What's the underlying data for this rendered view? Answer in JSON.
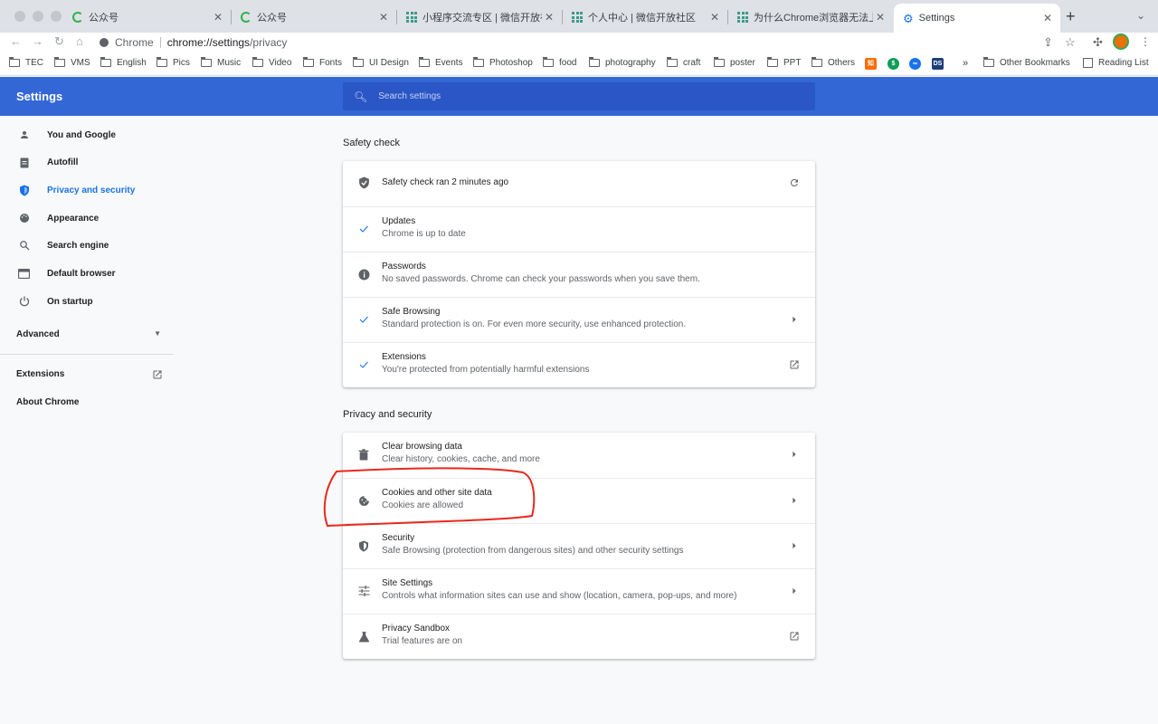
{
  "tabs": [
    {
      "title": "公众号",
      "favicon": "wechat-green-icon"
    },
    {
      "title": "公众号",
      "favicon": "wechat-green-icon"
    },
    {
      "title": "小程序交流专区 | 微信开放社区",
      "favicon": "wechat-dev-icon"
    },
    {
      "title": "个人中心 | 微信开放社区",
      "favicon": "wechat-dev-icon"
    },
    {
      "title": "为什么Chrome浏览器无法上传图",
      "favicon": "wechat-dev-icon"
    },
    {
      "title": "Settings",
      "favicon": "settings-gear-icon",
      "active": true
    }
  ],
  "toolbar": {
    "site_label": "Chrome",
    "url_host": "chrome://settings",
    "url_path": "/privacy"
  },
  "bookmarks": {
    "items": [
      "TEC",
      "VMS",
      "English",
      "Pics",
      "Music",
      "Video",
      "Fonts",
      "UI Design",
      "Events",
      "Photoshop",
      "food",
      "photography",
      "craft",
      "poster",
      "PPT",
      "Others"
    ],
    "badges": [
      {
        "text": "知",
        "color": "#ff6a00"
      },
      {
        "text": "$",
        "color": "#0f9d58"
      },
      {
        "text": "∞",
        "color": "#1a73e8"
      },
      {
        "text": "DS",
        "color": "#1d3f7a"
      }
    ],
    "more": "»",
    "other_bookmarks": "Other Bookmarks",
    "reading_list": "Reading List"
  },
  "header": {
    "title": "Settings",
    "search_placeholder": "Search settings"
  },
  "sidebar": {
    "items": [
      {
        "label": "You and Google",
        "icon": "person-icon"
      },
      {
        "label": "Autofill",
        "icon": "clipboard-icon"
      },
      {
        "label": "Privacy and security",
        "icon": "shield-icon",
        "active": true
      },
      {
        "label": "Appearance",
        "icon": "palette-icon"
      },
      {
        "label": "Search engine",
        "icon": "search-icon"
      },
      {
        "label": "Default browser",
        "icon": "browser-window-icon"
      },
      {
        "label": "On startup",
        "icon": "power-icon"
      }
    ],
    "advanced": "Advanced",
    "extensions": "Extensions",
    "about": "About Chrome"
  },
  "safety_check": {
    "title": "Safety check",
    "status": "Safety check ran 2 minutes ago",
    "rows": [
      {
        "title": "Updates",
        "subtitle": "Chrome is up to date",
        "icon": "check-icon"
      },
      {
        "title": "Passwords",
        "subtitle": "No saved passwords. Chrome can check your passwords when you save them.",
        "icon": "info-icon"
      },
      {
        "title": "Safe Browsing",
        "subtitle": "Standard protection is on. For even more security, use enhanced protection.",
        "icon": "check-icon"
      },
      {
        "title": "Extensions",
        "subtitle": "You're protected from potentially harmful extensions",
        "icon": "check-icon"
      }
    ]
  },
  "privacy": {
    "title": "Privacy and security",
    "rows": [
      {
        "title": "Clear browsing data",
        "subtitle": "Clear history, cookies, cache, and more",
        "icon": "trash-icon"
      },
      {
        "title": "Cookies and other site data",
        "subtitle": "Cookies are allowed",
        "icon": "cookie-icon"
      },
      {
        "title": "Security",
        "subtitle": "Safe Browsing (protection from dangerous sites) and other security settings",
        "icon": "shield-outline-icon"
      },
      {
        "title": "Site Settings",
        "subtitle": "Controls what information sites can use and show (location, camera, pop-ups, and more)",
        "icon": "sliders-icon"
      },
      {
        "title": "Privacy Sandbox",
        "subtitle": "Trial features are on",
        "icon": "flask-icon"
      }
    ]
  },
  "colors": {
    "header_blue": "#3367d6",
    "accent": "#1a73e8",
    "annotation_red": "#e8291c"
  }
}
